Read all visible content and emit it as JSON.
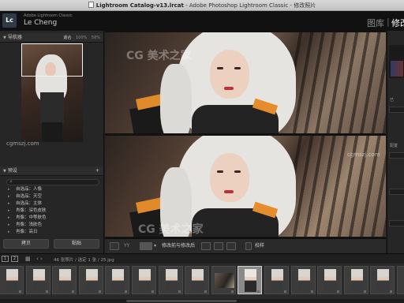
{
  "window": {
    "title_file": "Lightroom Catalog-v13.lrcat",
    "title_app": " - Adobe Photoshop Lightroom Classic - 修改照片"
  },
  "identity": {
    "badge": "Lc",
    "app_name": "Adobe Lightroom Classic",
    "user_name": "Le Cheng"
  },
  "modules": {
    "library": "图库",
    "separator": "|",
    "develop": "修改"
  },
  "navigator": {
    "title": "导航器",
    "zoom_options": [
      "适合",
      "100%",
      "50%"
    ]
  },
  "presets": {
    "title": "预设",
    "items": [
      "自选品：人像",
      "自选品：天空",
      "自选品：主体",
      "肖像：深色皮肤",
      "肖像：中等肤色",
      "肖像：浅肤色",
      "肖像：高日"
    ]
  },
  "left_buttons": {
    "copy": "拷贝",
    "paste": "粘贴"
  },
  "toolbar": {
    "compare_label": "修改前与修改后",
    "softproof_label": "校样"
  },
  "rightpanel": {
    "label_top": "已",
    "label_mid": "配置"
  },
  "filmstrip": {
    "monitor1": "1",
    "monitor2": "2",
    "grid_icon": "▦",
    "nav": "‹ ›",
    "path": "46 张照片 / 选定 1 张 / 25.jpg",
    "thumbs": [
      {
        "kind": "portrait"
      },
      {
        "kind": "portrait"
      },
      {
        "kind": "portrait"
      },
      {
        "kind": "portrait"
      },
      {
        "kind": "portrait"
      },
      {
        "kind": "portrait"
      },
      {
        "kind": "portrait"
      },
      {
        "kind": "portrait"
      },
      {
        "kind": "landscape"
      },
      {
        "kind": "selected"
      },
      {
        "kind": "portrait"
      },
      {
        "kind": "portrait"
      },
      {
        "kind": "portrait"
      },
      {
        "kind": "portrait"
      },
      {
        "kind": "portrait"
      },
      {
        "kind": "portrait"
      }
    ]
  },
  "watermarks": {
    "site": "cgmszj.com",
    "brand": "CG 美术之家"
  }
}
